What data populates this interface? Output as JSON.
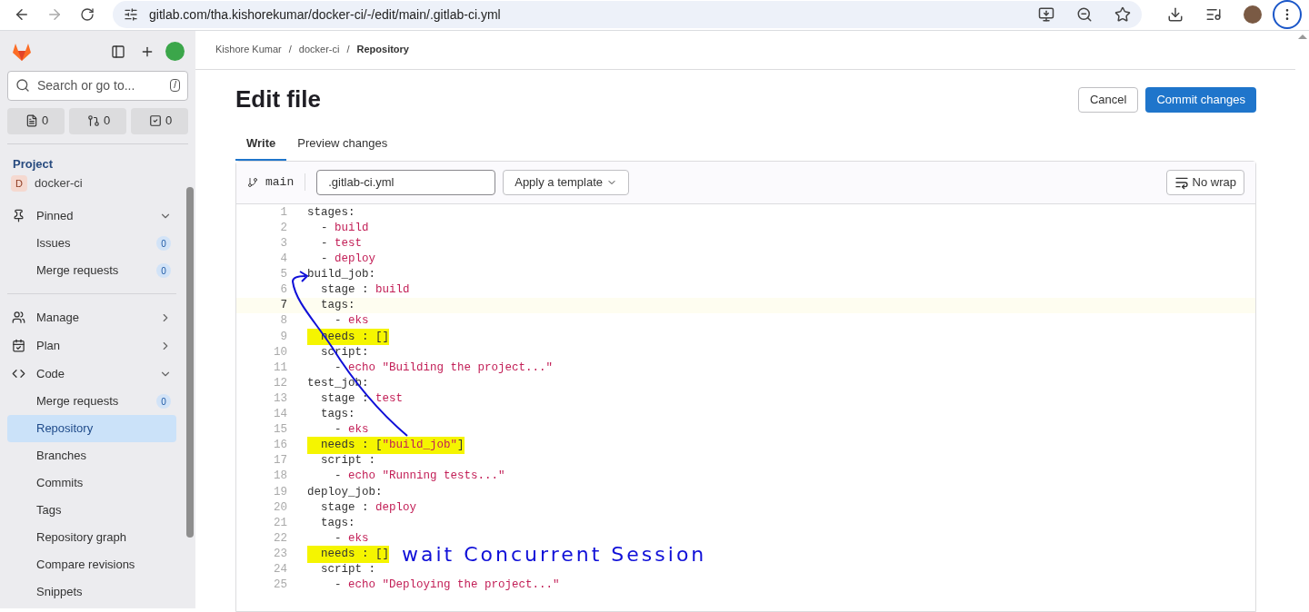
{
  "browser": {
    "url": "gitlab.com/tha.kishorekumar/docker-ci/-/edit/main/.gitlab-ci.yml"
  },
  "sidebar": {
    "search": {
      "placeholder": "Search or go to...",
      "shortcut": "/"
    },
    "counts": [
      {
        "kind": "issues",
        "count": "0"
      },
      {
        "kind": "merge",
        "count": "0"
      },
      {
        "kind": "todo",
        "count": "0"
      }
    ],
    "section": "Project",
    "project": {
      "initial": "D",
      "name": "docker-ci"
    },
    "items": [
      {
        "kind": "group",
        "label": "Pinned",
        "expanded": true,
        "children": [
          {
            "label": "Issues",
            "badge": "0",
            "selected": false
          },
          {
            "label": "Merge requests",
            "badge": "0",
            "selected": false
          }
        ]
      },
      {
        "kind": "divider"
      },
      {
        "kind": "group",
        "label": "Manage",
        "expanded": false
      },
      {
        "kind": "group",
        "label": "Plan",
        "expanded": false
      },
      {
        "kind": "group",
        "label": "Code",
        "expanded": true,
        "children": [
          {
            "label": "Merge requests",
            "badge": "0",
            "selected": false
          },
          {
            "label": "Repository",
            "selected": true
          },
          {
            "label": "Branches",
            "selected": false
          },
          {
            "label": "Commits",
            "selected": false
          },
          {
            "label": "Tags",
            "selected": false
          },
          {
            "label": "Repository graph",
            "selected": false
          },
          {
            "label": "Compare revisions",
            "selected": false
          },
          {
            "label": "Snippets",
            "selected": false
          }
        ]
      }
    ]
  },
  "breadcrumb": {
    "separator": "/",
    "items": [
      "Kishore Kumar",
      "docker-ci",
      "Repository"
    ]
  },
  "title": "Edit file",
  "buttons": {
    "cancel": "Cancel",
    "commit": "Commit changes"
  },
  "tabs": [
    {
      "label": "Write",
      "selected": true
    },
    {
      "label": "Preview changes",
      "selected": false
    }
  ],
  "editor": {
    "branch": "main",
    "filename": ".gitlab-ci.yml",
    "template": "Apply a template",
    "wrap": "No wrap",
    "lines": [
      {
        "number": "1",
        "code": "stages:",
        "highlighted": false,
        "current": false
      },
      {
        "number": "2",
        "code": "  - ",
        "value": "build",
        "highlighted": false,
        "current": false
      },
      {
        "number": "3",
        "code": "  - ",
        "value": "test",
        "highlighted": false,
        "current": false
      },
      {
        "number": "4",
        "code": "  - ",
        "value": "deploy",
        "highlighted": false,
        "current": false
      },
      {
        "number": "5",
        "code": "build_job:",
        "highlighted": false,
        "current": false
      },
      {
        "number": "6",
        "code": "  stage : ",
        "value": "build",
        "highlighted": false,
        "current": false
      },
      {
        "number": "7",
        "code": "  tags:",
        "highlighted": false,
        "current": true
      },
      {
        "number": "8",
        "code": "    - ",
        "value": "eks",
        "highlighted": false,
        "current": false
      },
      {
        "number": "9",
        "code": "  needs : []",
        "highlighted": true,
        "current": false
      },
      {
        "number": "10",
        "code": "  script:",
        "highlighted": false,
        "current": false
      },
      {
        "number": "11",
        "code": "    - ",
        "value": "echo \"Building the project...\"",
        "highlighted": false,
        "current": false
      },
      {
        "number": "12",
        "code": "test_job:",
        "highlighted": false,
        "current": false
      },
      {
        "number": "13",
        "code": "  stage : ",
        "value": "test",
        "highlighted": false,
        "current": false
      },
      {
        "number": "14",
        "code": "  tags:",
        "highlighted": false,
        "current": false
      },
      {
        "number": "15",
        "code": "    - ",
        "value": "eks",
        "highlighted": false,
        "current": false
      },
      {
        "number": "16",
        "code": "  needs : [",
        "value": "\"build_job\"",
        "tail": "]",
        "highlighted": true,
        "current": false
      },
      {
        "number": "17",
        "code": "  script :",
        "highlighted": false,
        "current": false
      },
      {
        "number": "18",
        "code": "    - ",
        "value": "echo \"Running tests...\"",
        "highlighted": false,
        "current": false
      },
      {
        "number": "19",
        "code": "deploy_job:",
        "highlighted": false,
        "current": false
      },
      {
        "number": "20",
        "code": "  stage : ",
        "value": "deploy",
        "highlighted": false,
        "current": false
      },
      {
        "number": "21",
        "code": "  tags:",
        "highlighted": false,
        "current": false
      },
      {
        "number": "22",
        "code": "    - ",
        "value": "eks",
        "highlighted": false,
        "current": false
      },
      {
        "number": "23",
        "code": "  needs : []",
        "highlighted": true,
        "current": false,
        "note": "wait Concurrent Session"
      },
      {
        "number": "24",
        "code": "  script :",
        "highlighted": false,
        "current": false
      },
      {
        "number": "25",
        "code": "    - ",
        "value": "echo \"Deploying the project...\"",
        "highlighted": false,
        "current": false
      }
    ]
  }
}
